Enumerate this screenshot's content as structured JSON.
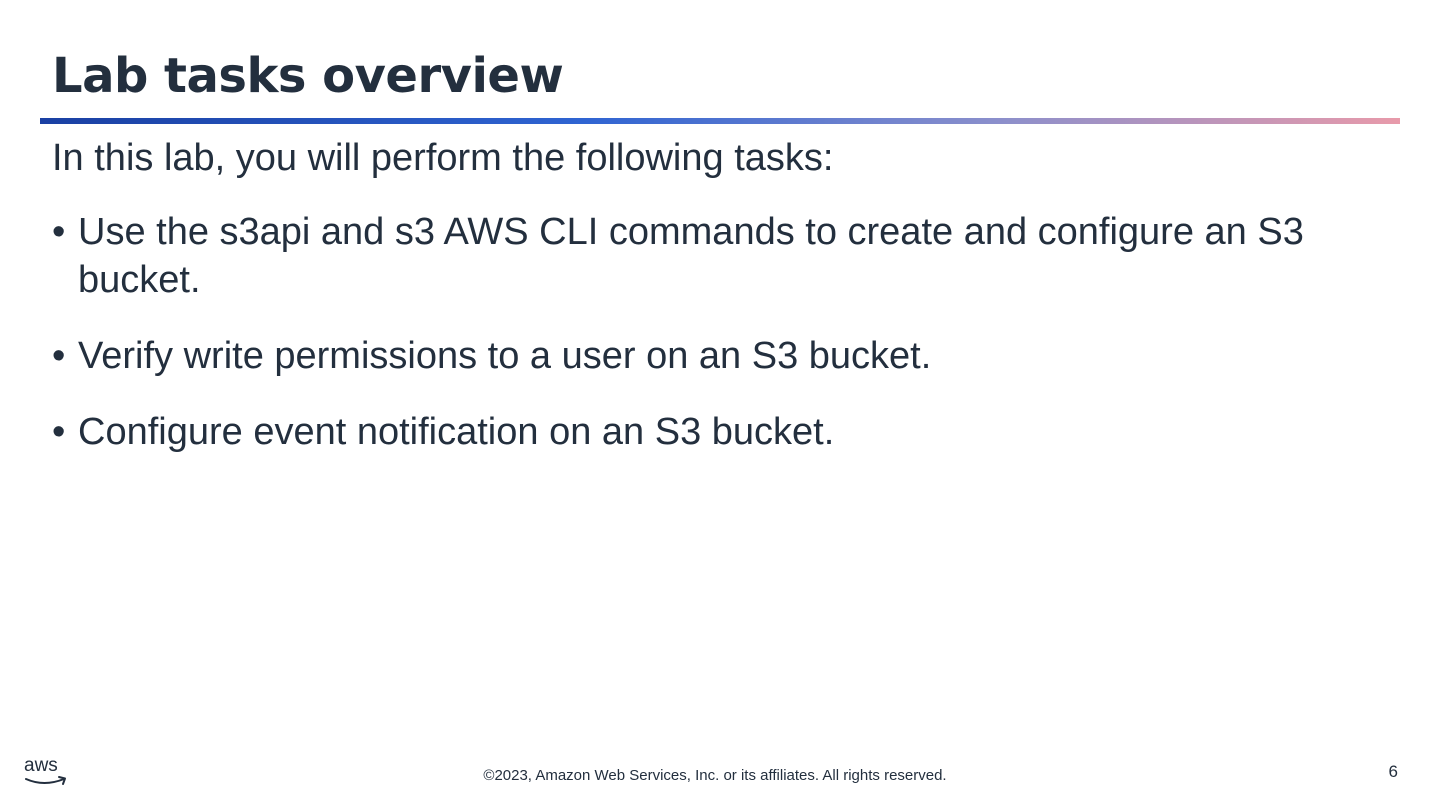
{
  "slide": {
    "title": "Lab tasks overview",
    "intro": "In this lab, you will perform the following tasks:",
    "tasks": [
      "Use the s3api and s3 AWS CLI commands to create and configure an S3 bucket.",
      "Verify write permissions to a user on an S3 bucket.",
      "Configure event notification on an S3 bucket."
    ],
    "bullet": "•"
  },
  "footer": {
    "logo_text": "aws",
    "logo_icon": "aws-smile-arrow-icon",
    "copyright": "©2023, Amazon Web Services, Inc. or its affiliates. All rights reserved.",
    "page_number": "6"
  },
  "colors": {
    "text": "#232f3e",
    "rule_start": "#1a40a3",
    "rule_mid": "#2f64d2",
    "rule_end": "#e89aaa"
  }
}
